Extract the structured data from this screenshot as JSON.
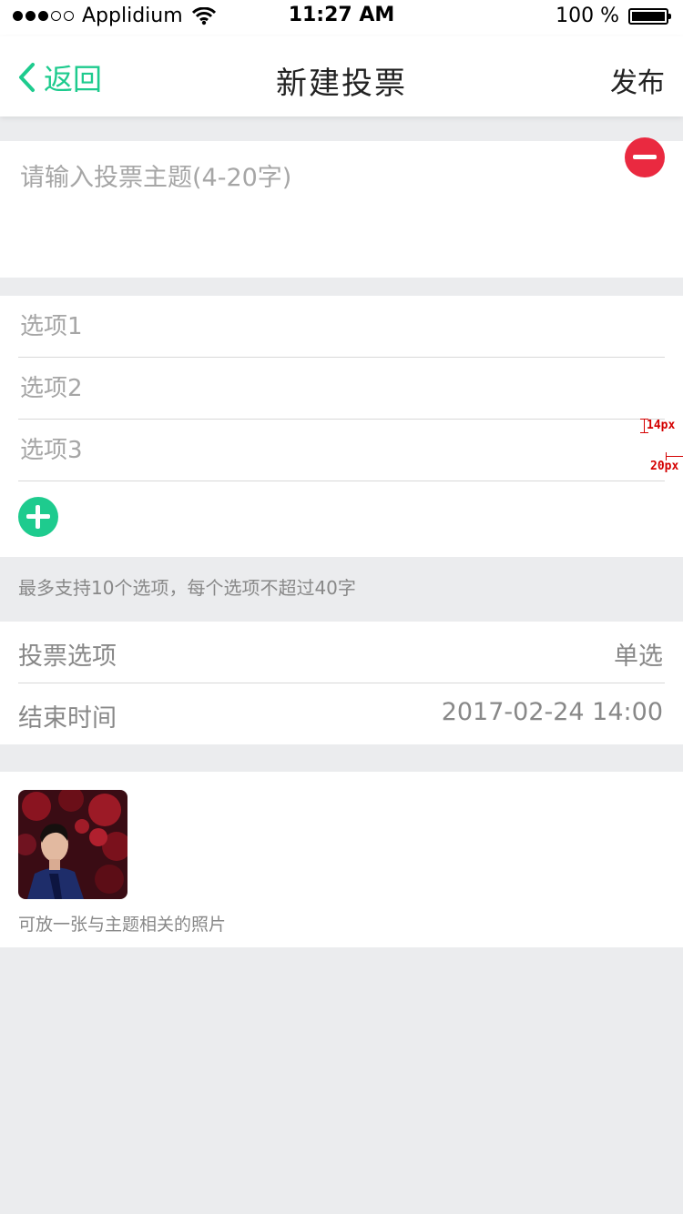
{
  "status_bar": {
    "carrier": "Applidium",
    "time": "11:27 AM",
    "battery": "100 %"
  },
  "nav": {
    "back_label": "返回",
    "title": "新建投票",
    "publish_label": "发布",
    "accent_color": "#1ecb8e"
  },
  "topic": {
    "placeholder": "请输入投票主题(4-20字)",
    "value": ""
  },
  "options": [
    {
      "placeholder": "选项1",
      "value": ""
    },
    {
      "placeholder": "选项2",
      "value": ""
    },
    {
      "placeholder": "选项3",
      "value": ""
    }
  ],
  "annotations": {
    "top_gap": "14px",
    "right_gap": "20px"
  },
  "hint": "最多支持10个选项，每个选项不超过40字",
  "settings": {
    "vote_type_label": "投票选项",
    "vote_type_value": "单选",
    "end_time_label": "结束时间",
    "end_time_value": "2017-02-24 14:00"
  },
  "photo": {
    "caption": "可放一张与主题相关的照片"
  },
  "colors": {
    "remove": "#ea2940",
    "add": "#1ecb8e"
  }
}
